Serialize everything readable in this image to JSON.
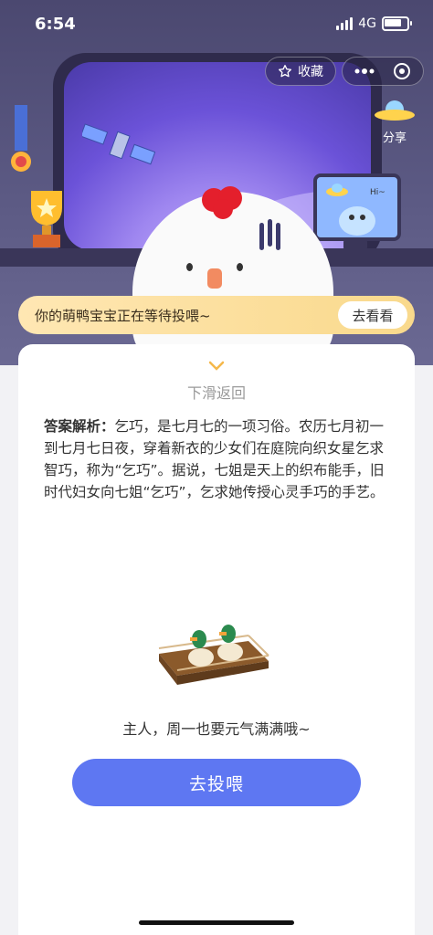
{
  "status_bar": {
    "time": "6:54",
    "network": "4G",
    "battery_level": 0.9
  },
  "toolbar": {
    "favorite_label": "收藏",
    "share_label": "分享"
  },
  "banner": {
    "message": "你的萌鸭宝宝正在等待投喂~",
    "button_label": "去看看"
  },
  "scene": {
    "monitor_text": "Hi~"
  },
  "card": {
    "slide_back_label": "下滑返回",
    "analysis_title": "答案解析：",
    "analysis_text": "乞巧，是七月七的一项习俗。农历七月初一到七月七日夜，穿着新衣的少女们在庭院向织女星乞求智巧，称为“乞巧”。据说，七姐是天上的织布能手，旧时代妇女向七姐“乞巧”，乞求她传授心灵手巧的手艺。",
    "cheer_text": "主人，周一也要元气满满哦~",
    "feed_button_label": "去投喂"
  },
  "colors": {
    "primary_button": "#5e77f2",
    "banner_start": "#ffe7b3",
    "banner_end": "#f9d98c"
  }
}
